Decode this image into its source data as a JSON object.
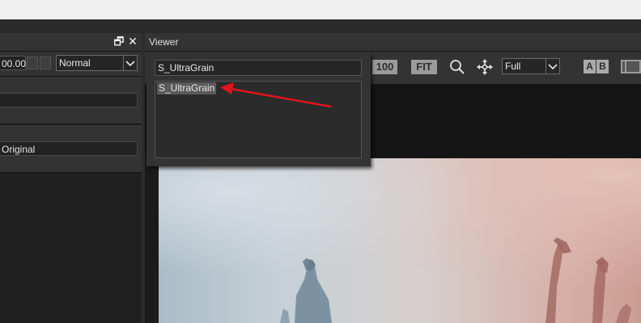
{
  "left_panel": {
    "value_field": "00.00",
    "blend_mode": "Normal",
    "source_field": "Original",
    "restore_glyph": "🗗",
    "close_glyph": "✕"
  },
  "viewer": {
    "title": "Viewer",
    "zoom_100": "100",
    "zoom_fit": "FIT",
    "resolution": "Full",
    "ab_a": "A",
    "ab_b": "B"
  },
  "popup": {
    "search_value": "S_UltraGrain",
    "items": [
      "S_UltraGrain"
    ]
  },
  "colors": {
    "annotation_arrow": "#e0141b"
  }
}
